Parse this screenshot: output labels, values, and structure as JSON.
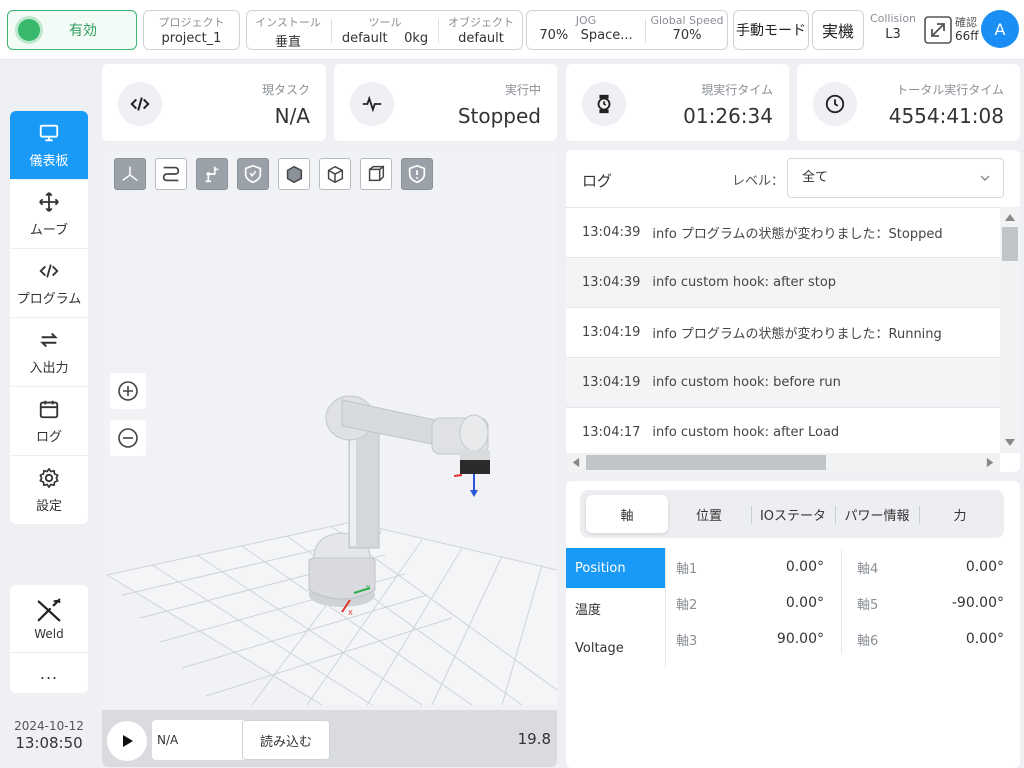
{
  "topbar": {
    "status": "有効",
    "project": {
      "label": "プロジェクト",
      "value": "project_1"
    },
    "install": {
      "label": "インストール",
      "value": "垂直"
    },
    "tool": {
      "label": "ツール",
      "value": "default",
      "value2": "0kg"
    },
    "object": {
      "label": "オブジェクト",
      "value": "default"
    },
    "jog": {
      "label": "JOG",
      "value": "70%",
      "value2": "Space..."
    },
    "global_speed": {
      "label": "Global Speed",
      "value": "70%"
    },
    "mode_button": "手動モード",
    "machine_button": "実機",
    "collision": {
      "label": "Collision",
      "value": "L3"
    },
    "confirm": {
      "label": "確認",
      "value": "66ff"
    },
    "avatar": "A"
  },
  "nav": {
    "items": [
      {
        "label": "儀表板",
        "icon": "monitor-icon"
      },
      {
        "label": "ムーブ",
        "icon": "move-icon"
      },
      {
        "label": "プログラム",
        "icon": "code-icon"
      },
      {
        "label": "入出力",
        "icon": "io-icon"
      },
      {
        "label": "ログ",
        "icon": "calendar-icon"
      },
      {
        "label": "設定",
        "icon": "gear-icon"
      }
    ],
    "weld": "Weld",
    "more": "..."
  },
  "datetime": {
    "date": "2024-10-12",
    "time": "13:08:50"
  },
  "cards": {
    "task": {
      "label": "現タスク",
      "value": "N/A"
    },
    "running": {
      "label": "実行中",
      "value": "Stopped"
    },
    "runtime": {
      "label": "現実行タイム",
      "value": "01:26:34"
    },
    "total": {
      "label": "トータル実行タイム",
      "value": "4554:41:08"
    }
  },
  "viewport": {
    "program": "N/A",
    "load_button": "読み込む",
    "fps": "19.8"
  },
  "log": {
    "title": "ログ",
    "level_label": "レベル：",
    "level_value": "全て",
    "entries": [
      {
        "time": "13:04:39",
        "text": "info  プログラムの状態が変わりました：Stopped"
      },
      {
        "time": "13:04:39",
        "text": "info custom hook: after stop"
      },
      {
        "time": "13:04:19",
        "text": "info  プログラムの状態が変わりました：Running"
      },
      {
        "time": "13:04:19",
        "text": "info custom hook: before run"
      },
      {
        "time": "13:04:17",
        "text": "info custom hook: after Load"
      }
    ]
  },
  "joint": {
    "tabs": [
      "軸",
      "位置",
      "IOステータ",
      "パワー情報",
      "力"
    ],
    "side": [
      "Position",
      "温度",
      "Voltage"
    ],
    "axes": [
      {
        "label": "軸1",
        "value": "0.00°"
      },
      {
        "label": "軸2",
        "value": "0.00°"
      },
      {
        "label": "軸3",
        "value": "90.00°"
      },
      {
        "label": "軸4",
        "value": "0.00°"
      },
      {
        "label": "軸5",
        "value": "-90.00°"
      },
      {
        "label": "軸6",
        "value": "0.00°"
      }
    ]
  },
  "colors": {
    "accent": "#1a9af7",
    "enabled": "#37b86a"
  }
}
